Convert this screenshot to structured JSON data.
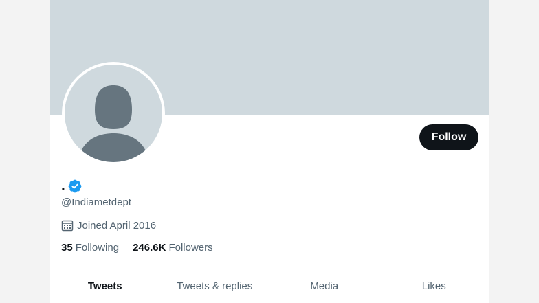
{
  "profile": {
    "display_name": ".",
    "handle": "@Indiametdept",
    "joined": "Joined April 2016",
    "verified": true,
    "follow_label": "Follow"
  },
  "stats": {
    "following": {
      "value": "35",
      "label": "Following"
    },
    "followers": {
      "value": "246.6K",
      "label": "Followers"
    }
  },
  "tabs": [
    {
      "label": "Tweets",
      "active": true
    },
    {
      "label": "Tweets & replies",
      "active": false
    },
    {
      "label": "Media",
      "active": false
    },
    {
      "label": "Likes",
      "active": false
    }
  ],
  "icons": {
    "verified": "verified-badge-icon",
    "calendar": "calendar-icon",
    "avatar": "default-avatar-icon"
  },
  "colors": {
    "banner": "#cfd9de",
    "verified": "#1d9bf0",
    "follow_bg": "#0f1419",
    "secondary_text": "#536471"
  }
}
